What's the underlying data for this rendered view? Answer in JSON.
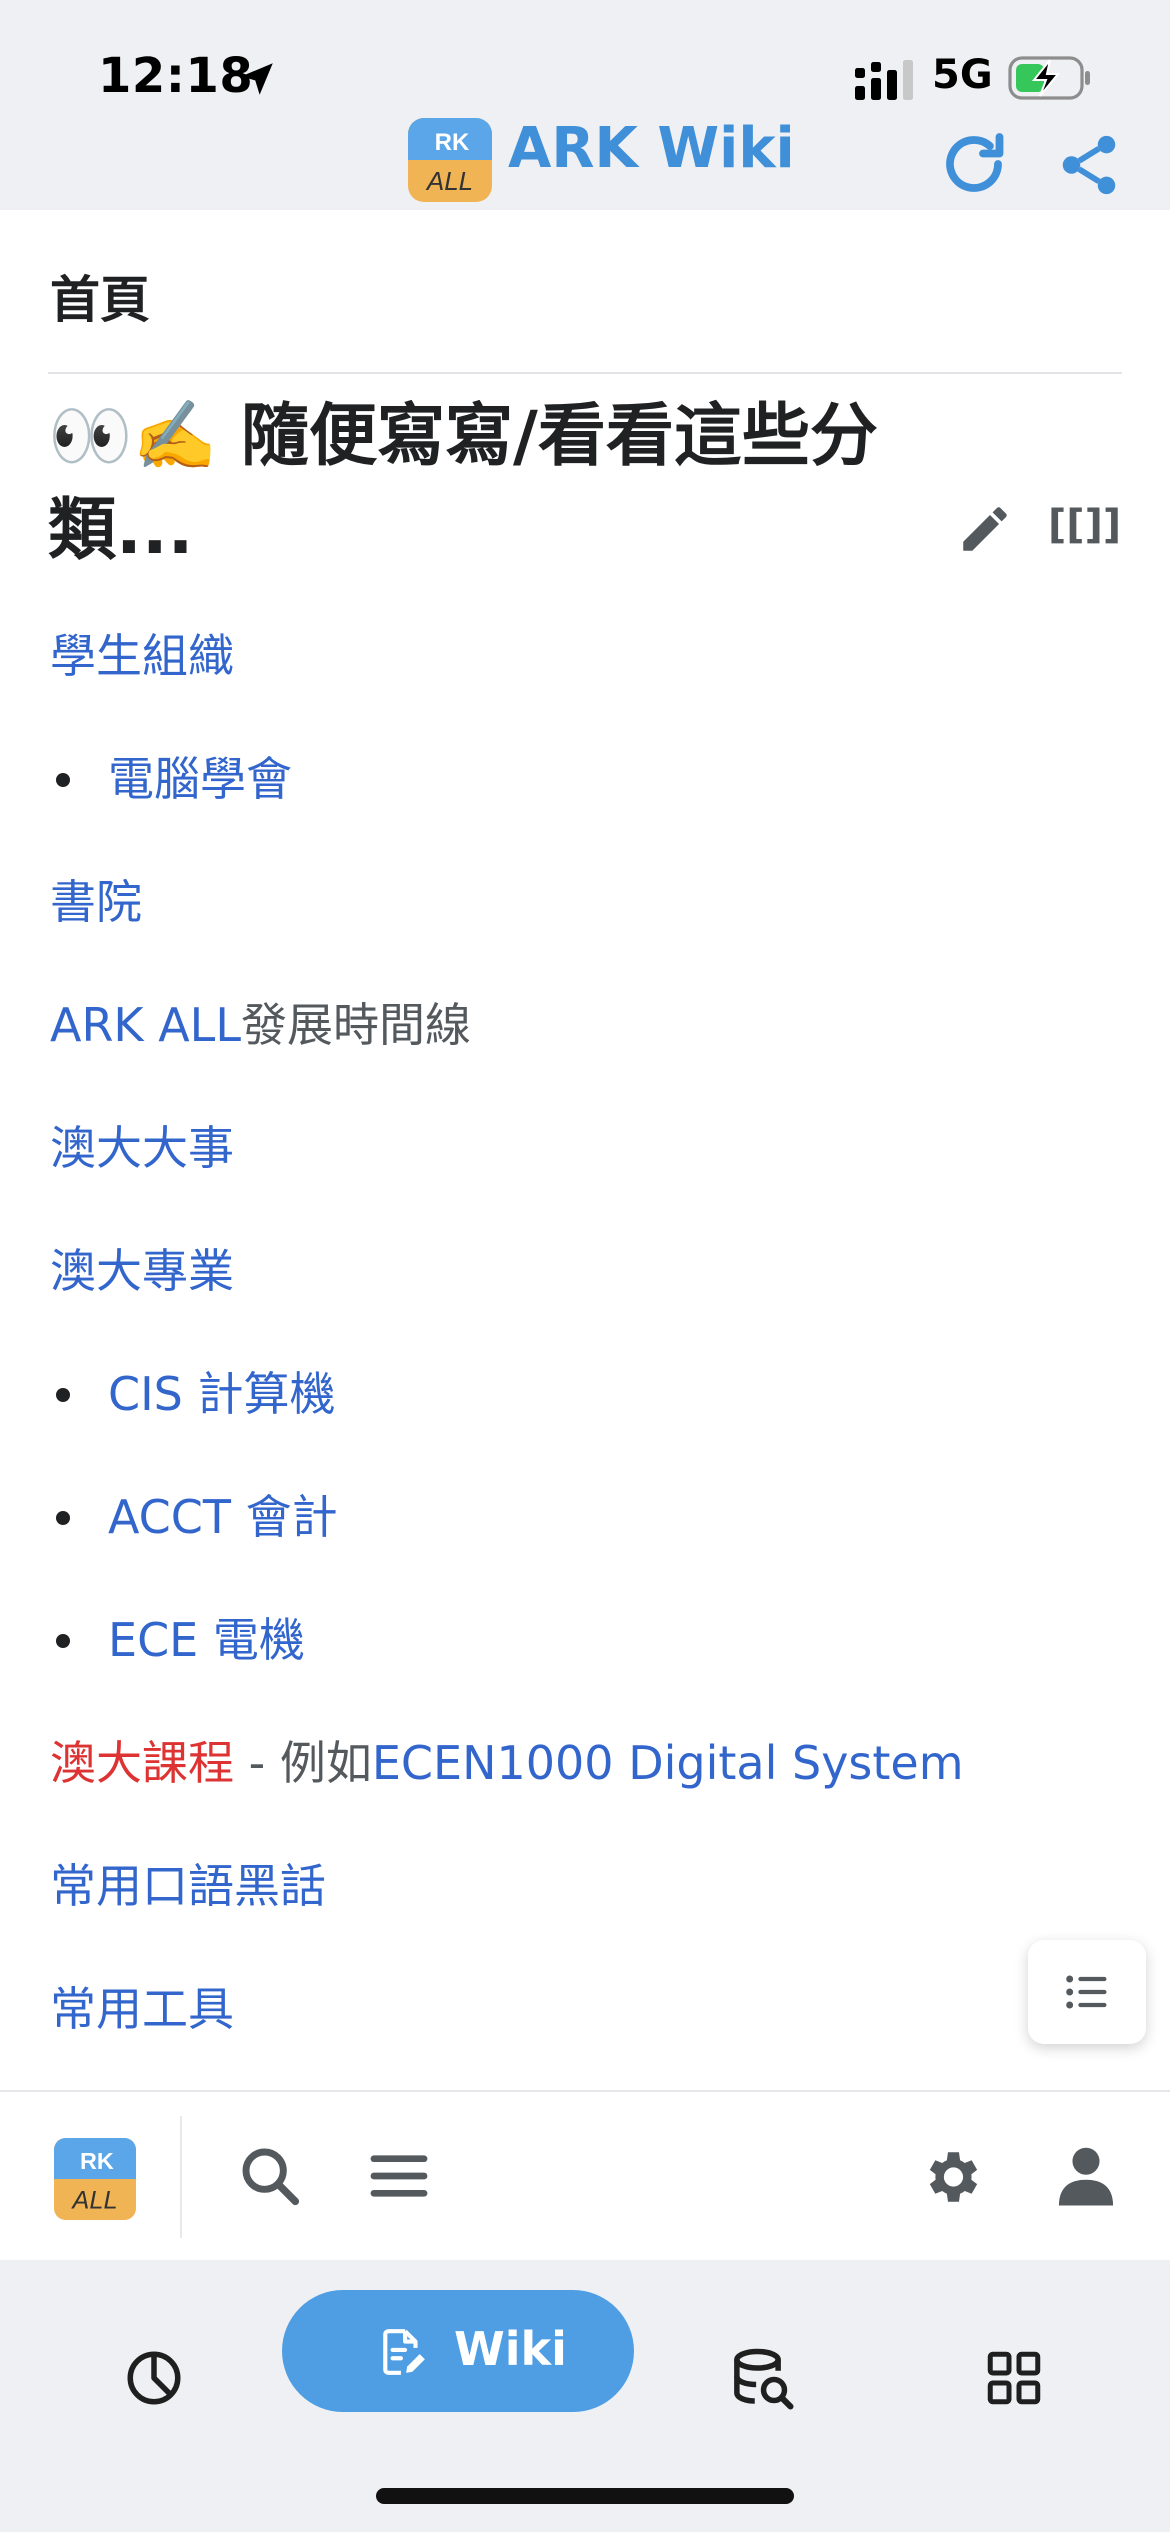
{
  "status_bar": {
    "time": "12:18",
    "network": "5G"
  },
  "app_header": {
    "title": "ARK Wiki",
    "logo_text_top": "RK",
    "logo_text_bottom": "ALL"
  },
  "page": {
    "name": "首頁",
    "heading": "👀✍️ 隨便寫寫/看看這些分類...",
    "wikilink_label": "[[]]",
    "items": [
      {
        "parts": [
          {
            "text": "學生組織",
            "style": "link"
          }
        ]
      },
      {
        "bullet": true,
        "parts": [
          {
            "text": "電腦學會",
            "style": "link"
          }
        ]
      },
      {
        "parts": [
          {
            "text": "書院",
            "style": "link"
          }
        ]
      },
      {
        "parts": [
          {
            "text": "ARK ALL",
            "style": "link"
          },
          {
            "text": "發展時間線",
            "style": "plain"
          }
        ]
      },
      {
        "parts": [
          {
            "text": "澳大大事",
            "style": "link"
          }
        ]
      },
      {
        "parts": [
          {
            "text": "澳大專業",
            "style": "link"
          }
        ]
      },
      {
        "bullet": true,
        "parts": [
          {
            "text": "CIS 計算機",
            "style": "link"
          }
        ]
      },
      {
        "bullet": true,
        "parts": [
          {
            "text": "ACCT 會計",
            "style": "link"
          }
        ]
      },
      {
        "bullet": true,
        "parts": [
          {
            "text": "ECE 電機",
            "style": "link"
          }
        ]
      },
      {
        "parts": [
          {
            "text": "澳大課程",
            "style": "red"
          },
          {
            "text": " - 例如",
            "style": "plain"
          },
          {
            "text": "ECEN1000 Digital System",
            "style": "link"
          }
        ]
      },
      {
        "parts": [
          {
            "text": "常用口語黑話",
            "style": "link"
          }
        ]
      },
      {
        "parts": [
          {
            "text": "常用工具",
            "style": "link"
          }
        ]
      }
    ]
  },
  "tab_bar": {
    "active_label": "Wiki"
  },
  "colors": {
    "accent": "#4f9ee3",
    "link": "#3366cc",
    "red_link": "#dd3333",
    "text": "#202122"
  },
  "icons": [
    "location-arrow-icon",
    "signal-icon",
    "battery-charging-icon",
    "refresh-icon",
    "share-icon",
    "edit-pencil-icon",
    "toc-list-icon",
    "search-icon",
    "menu-icon",
    "gear-icon",
    "user-icon",
    "pie-chart-icon",
    "document-edit-icon",
    "database-search-icon",
    "grid-icon"
  ]
}
